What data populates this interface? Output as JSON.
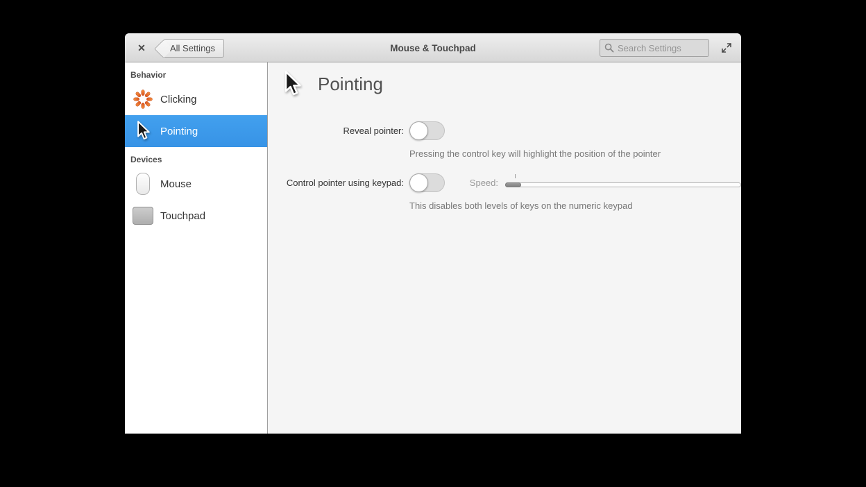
{
  "window": {
    "title": "Mouse & Touchpad",
    "close_glyph": "✕",
    "back_button": "All Settings",
    "search_placeholder": "Search Settings"
  },
  "sidebar": {
    "sections": [
      {
        "header": "Behavior",
        "items": [
          {
            "label": "Clicking",
            "icon": "clicking-starburst-icon",
            "selected": false
          },
          {
            "label": "Pointing",
            "icon": "pointer-cursor-icon",
            "selected": true
          }
        ]
      },
      {
        "header": "Devices",
        "items": [
          {
            "label": "Mouse",
            "icon": "mouse-icon",
            "selected": false
          },
          {
            "label": "Touchpad",
            "icon": "touchpad-icon",
            "selected": false
          }
        ]
      }
    ]
  },
  "content": {
    "heading": "Pointing",
    "rows": [
      {
        "label": "Reveal pointer:",
        "toggle_state": "off",
        "description": "Pressing the control key will highlight the position of the pointer"
      },
      {
        "label": "Control pointer using keypad:",
        "toggle_state": "off",
        "speed_label": "Speed:",
        "slider_value": 0,
        "description": "This disables both levels of keys on the numeric keypad"
      }
    ]
  },
  "colors": {
    "accent_selected": "#3d9aec",
    "selected_text": "#ffffff",
    "titlebar_bg": "#e2e2e2",
    "sidebar_bg": "#ffffff",
    "content_bg": "#f5f5f5",
    "icon_orange": "#e66a2e",
    "description_text": "#787878"
  }
}
